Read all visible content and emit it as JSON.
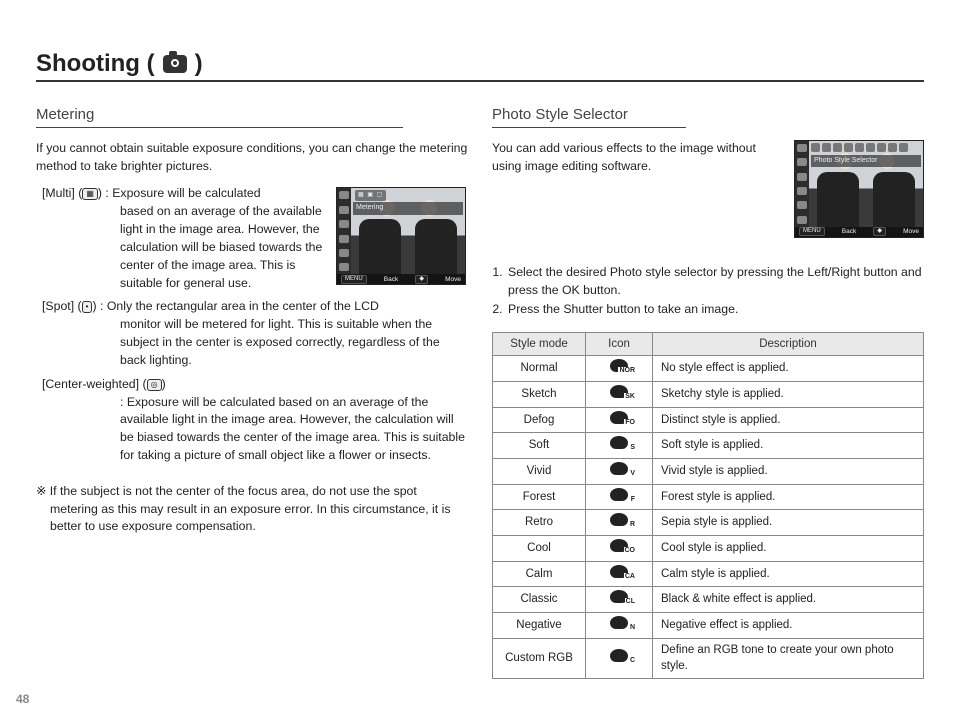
{
  "page_number": "48",
  "title_prefix": "Shooting (",
  "title_suffix": " )",
  "left": {
    "heading": "Metering",
    "intro": "If you cannot obtain suitable exposure conditions, you can change the metering method to take brighter pictures.",
    "lcd": {
      "mode_label": "Metering",
      "topbar_glyphs": "▦ ▣ ▢",
      "back": "Back",
      "move": "Move",
      "menu": "MENU"
    },
    "modes": [
      {
        "label": "[Multi] (",
        "label_end": ") :",
        "glyph": "▦",
        "desc_inline": " Exposure will be calculated",
        "desc_block": "based on an average of the available light in the image area. However, the calculation will be biased towards the center of the image area. This is suitable for general use."
      },
      {
        "label": "[Spot] (",
        "label_end": ") :",
        "glyph": "•",
        "desc_inline": " Only the rectangular area in the center of the LCD",
        "desc_block": "monitor will be metered for light. This is suitable when the subject in the center is exposed correctly, regardless of the back lighting."
      },
      {
        "label": "[Center-weighted] (",
        "label_end": ")",
        "glyph": "◎",
        "desc_inline": "",
        "desc_block": ": Exposure will be calculated based on an average of the available light in the image area. However, the calculation will be biased towards the center of the image area. This is suitable for taking a picture of small object like a flower or insects."
      }
    ],
    "note": "※ If the subject is not the center of the focus area, do not use the spot metering as this may result in an exposure error. In this circumstance, it is better to use exposure compensation."
  },
  "right": {
    "heading": "Photo Style Selector",
    "intro": "You can add various effects to the image without using image editing software.",
    "lcd": {
      "caption": "Photo Style Selector",
      "back": "Back",
      "move": "Move",
      "menu": "MENU"
    },
    "steps": [
      "Select the desired Photo style selector by pressing the Left/Right button and press the OK button.",
      "Press the Shutter button to take an image."
    ],
    "table": {
      "headers": [
        "Style mode",
        "Icon",
        "Description"
      ],
      "rows": [
        {
          "mode": "Normal",
          "tag": "NOR",
          "desc": "No style effect is applied."
        },
        {
          "mode": "Sketch",
          "tag": "SK",
          "desc": "Sketchy style is applied."
        },
        {
          "mode": "Defog",
          "tag": "FO",
          "desc": "Distinct style is applied."
        },
        {
          "mode": "Soft",
          "tag": "S",
          "desc": "Soft style is applied."
        },
        {
          "mode": "Vivid",
          "tag": "V",
          "desc": "Vivid style is applied."
        },
        {
          "mode": "Forest",
          "tag": "F",
          "desc": "Forest style is applied."
        },
        {
          "mode": "Retro",
          "tag": "R",
          "desc": "Sepia style is applied."
        },
        {
          "mode": "Cool",
          "tag": "CO",
          "desc": "Cool style is applied."
        },
        {
          "mode": "Calm",
          "tag": "CA",
          "desc": "Calm style is applied."
        },
        {
          "mode": "Classic",
          "tag": "CL",
          "desc": "Black & white effect is applied."
        },
        {
          "mode": "Negative",
          "tag": "N",
          "desc": "Negative effect is applied."
        },
        {
          "mode": "Custom RGB",
          "tag": "C",
          "desc": "Define an RGB tone to create your own photo style."
        }
      ]
    }
  }
}
